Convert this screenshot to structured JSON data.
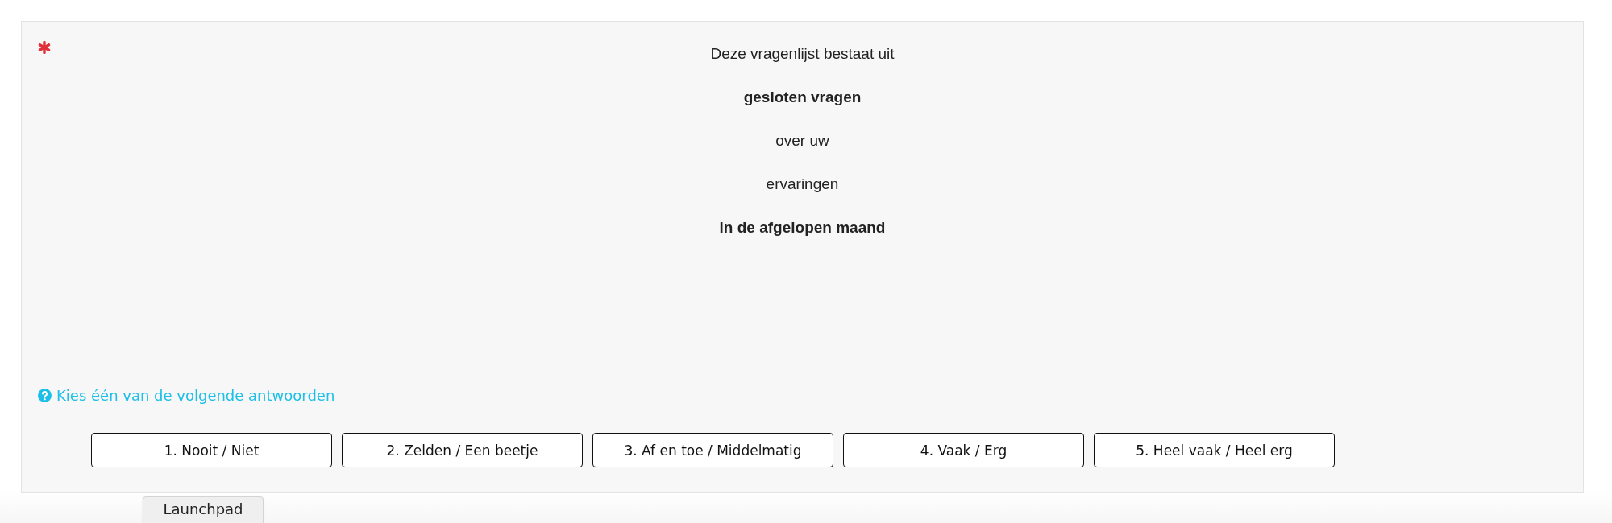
{
  "question": {
    "required": true,
    "lines": [
      {
        "text": "Deze vragenlijst bestaat uit",
        "bold": false
      },
      {
        "text": "gesloten vragen",
        "bold": true
      },
      {
        "text": "over uw",
        "bold": false
      },
      {
        "text": "ervaringen",
        "bold": false
      },
      {
        "text": "in de afgelopen maand",
        "bold": true
      }
    ],
    "help": "Kies één van de volgende antwoorden",
    "answers": [
      {
        "label": "1. Nooit / Niet",
        "selected": false
      },
      {
        "label": "2. Zelden / Een beetje",
        "selected": false
      },
      {
        "label": "3. Af en toe / Middelmatig",
        "selected": false
      },
      {
        "label": "4. Vaak / Erg",
        "selected": false
      },
      {
        "label": "5. Heel vaak / Heel erg",
        "selected": false
      }
    ]
  },
  "launchpad": {
    "label": "Launchpad"
  }
}
